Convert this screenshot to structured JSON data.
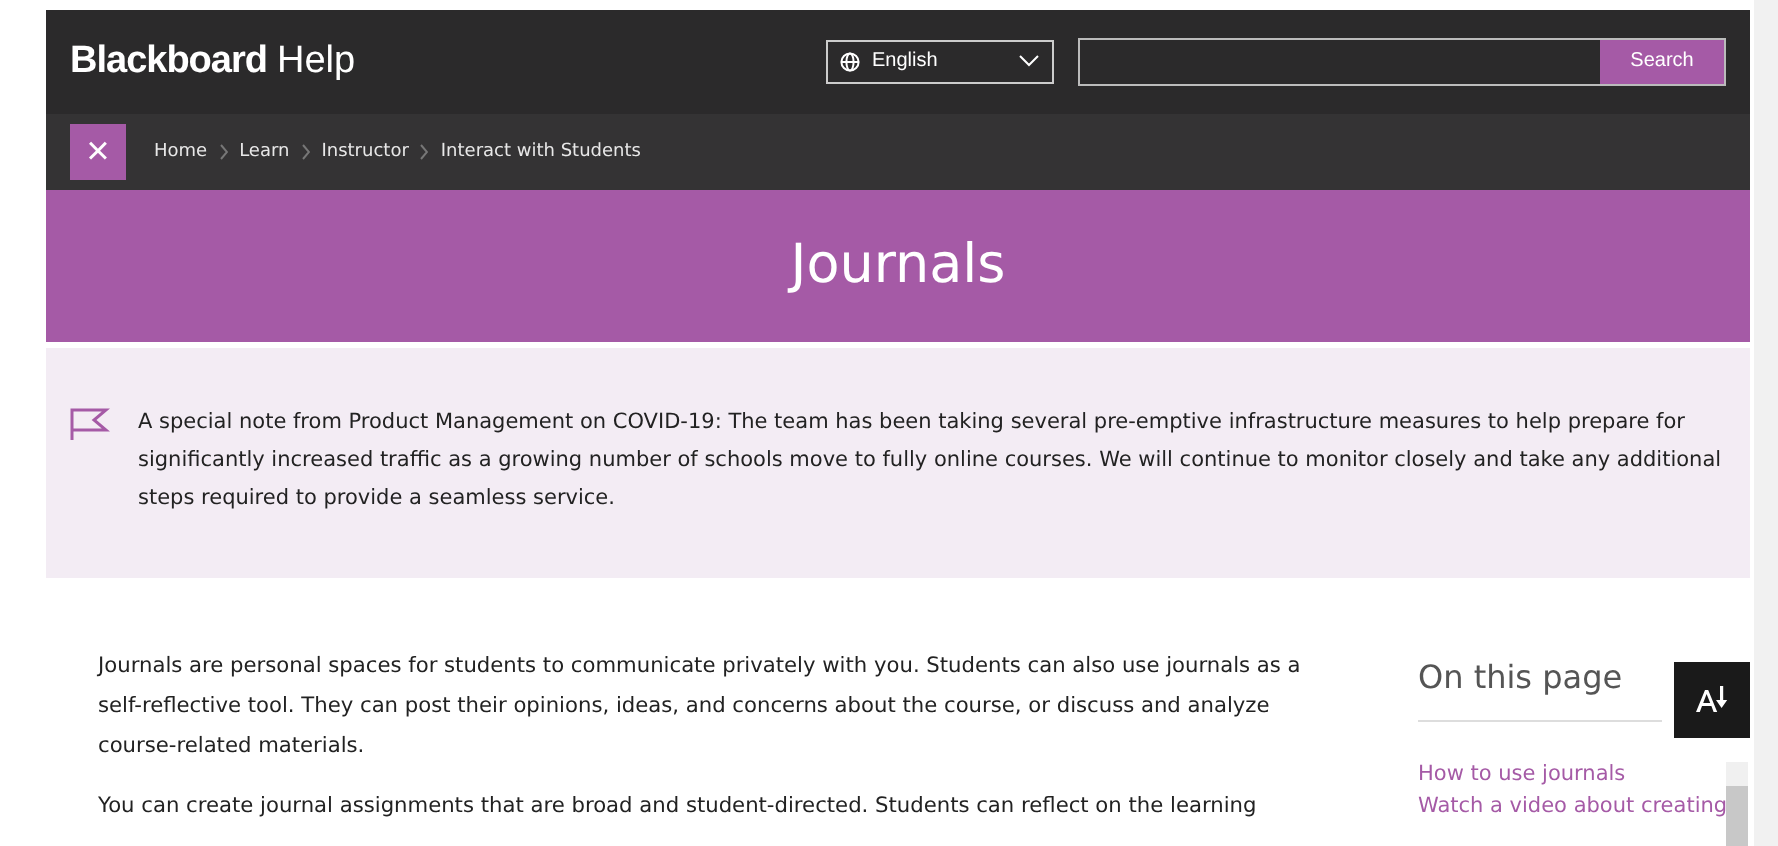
{
  "header": {
    "logo_bold": "Blackboard",
    "logo_light": "Help",
    "language": "English",
    "search_button": "Search"
  },
  "breadcrumb": {
    "close_symbol": "×",
    "items": [
      {
        "label": "Home"
      },
      {
        "label": "Learn"
      },
      {
        "label": "Instructor"
      },
      {
        "label": "Interact with Students"
      }
    ]
  },
  "banner": {
    "title": "Journals"
  },
  "notice": {
    "text": "A special note from Product Management on COVID-19: The team has been taking several pre-emptive infrastructure measures to help prepare for significantly increased traffic as a growing number of schools move to fully online courses. We will continue to monitor closely and take any additional steps required to provide a seamless service."
  },
  "article": {
    "paragraphs": [
      "Journals are personal spaces for students to communicate privately with you. Students can also use journals as a self-reflective tool. They can post their opinions, ideas, and concerns about the course, or discuss and analyze course-related materials.",
      "You can create journal assignments that are broad and student-directed. Students can reflect on the learning"
    ]
  },
  "sidebar": {
    "title": "On this page",
    "links": [
      {
        "label": "How to use journals"
      },
      {
        "label": "Watch a video about creating"
      }
    ]
  }
}
